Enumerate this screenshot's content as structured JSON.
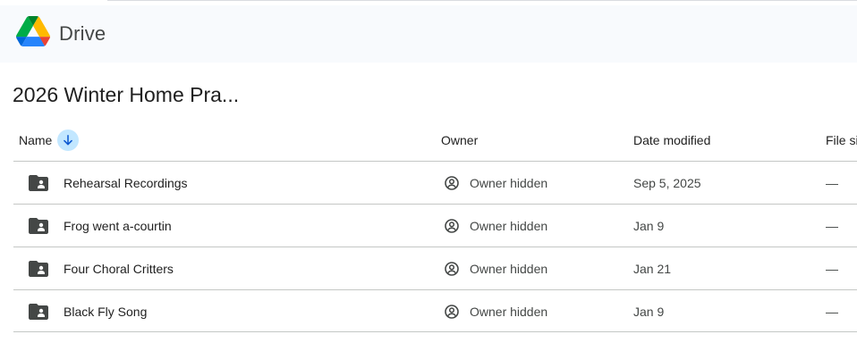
{
  "app": {
    "name": "Drive"
  },
  "folder": {
    "title": "2026 Winter Home Pra..."
  },
  "columns": {
    "name": "Name",
    "owner": "Owner",
    "date_modified": "Date modified",
    "file_size": "File si"
  },
  "rows": [
    {
      "name": "Rehearsal Recordings",
      "owner": "Owner hidden",
      "date": "Sep 5, 2025",
      "size": "—",
      "icon": "shared-folder-icon"
    },
    {
      "name": "Frog went a-courtin",
      "owner": "Owner hidden",
      "date": "Jan 9",
      "size": "—",
      "icon": "shared-folder-icon"
    },
    {
      "name": "Four Choral Critters",
      "owner": "Owner hidden",
      "date": "Jan 21",
      "size": "—",
      "icon": "shared-folder-icon"
    },
    {
      "name": "Black Fly Song",
      "owner": "Owner hidden",
      "date": "Jan 9",
      "size": "—",
      "icon": "shared-folder-icon"
    }
  ],
  "colors": {
    "header_bg": "#f8fafd",
    "sort_button_bg": "#c2e7ff",
    "sort_arrow": "#0b57d0",
    "divider": "#c4c7c5"
  }
}
